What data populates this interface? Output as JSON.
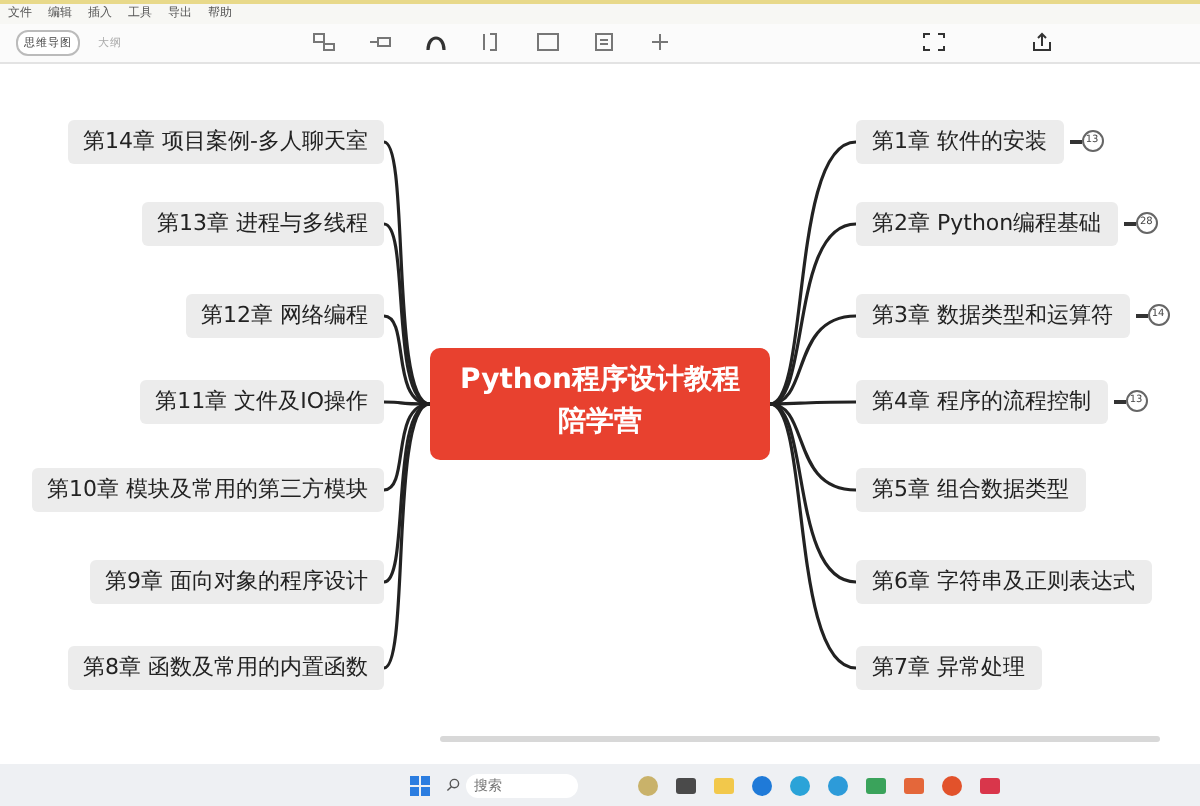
{
  "menu": [
    "文件",
    "编辑",
    "插入",
    "工具",
    "导出",
    "帮助"
  ],
  "view_tabs": [
    {
      "label": "思维导图",
      "selected": true
    },
    {
      "label": "大纲",
      "selected": false
    }
  ],
  "central_topic": {
    "line_1": "Python程序设计教程",
    "line_2": "陪学营"
  },
  "left_topics": [
    {
      "label": "第14章 项目案例-多人聊天室"
    },
    {
      "label": "第13章 进程与多线程"
    },
    {
      "label": "第12章 网络编程"
    },
    {
      "label": "第11章 文件及IO操作"
    },
    {
      "label": "第10章 模块及常用的第三方模块"
    },
    {
      "label": "第9章 面向对象的程序设计"
    },
    {
      "label": "第8章 函数及常用的内置函数"
    }
  ],
  "right_topics": [
    {
      "label": "第1章 软件的安装",
      "count": "13"
    },
    {
      "label": "第2章 Python编程基础",
      "count": "28"
    },
    {
      "label": "第3章 数据类型和运算符",
      "count": "14"
    },
    {
      "label": "第4章 程序的流程控制",
      "count": "13"
    },
    {
      "label": "第5章 组合数据类型"
    },
    {
      "label": "第6章 字符串及正则表达式"
    },
    {
      "label": "第7章 异常处理"
    }
  ],
  "taskbar": {
    "search_placeholder": "搜索"
  }
}
